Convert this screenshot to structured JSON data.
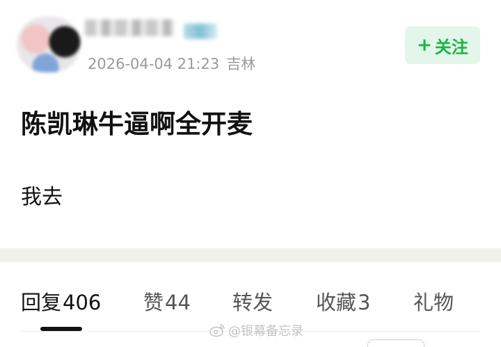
{
  "post": {
    "timestamp": "2026-04-04 21:23",
    "location": "吉林",
    "follow_plus": "+",
    "follow_label": "关注",
    "title": "陈凯琳牛逼啊全开麦",
    "body": "我去"
  },
  "tabs": [
    {
      "label": "回复",
      "count": "406",
      "active": true
    },
    {
      "label": "赞",
      "count": "44"
    },
    {
      "label": "转发",
      "count": ""
    },
    {
      "label": "收藏",
      "count": "3"
    },
    {
      "label": "礼物",
      "count": ""
    }
  ],
  "watermark": {
    "text": "@银幕备忘录",
    "icon": "weibo-icon"
  },
  "colors": {
    "follow_bg": "#e3f6e9",
    "follow_text": "#18b448",
    "meta_text": "#9a9a9a",
    "divider": "#f1efec"
  }
}
